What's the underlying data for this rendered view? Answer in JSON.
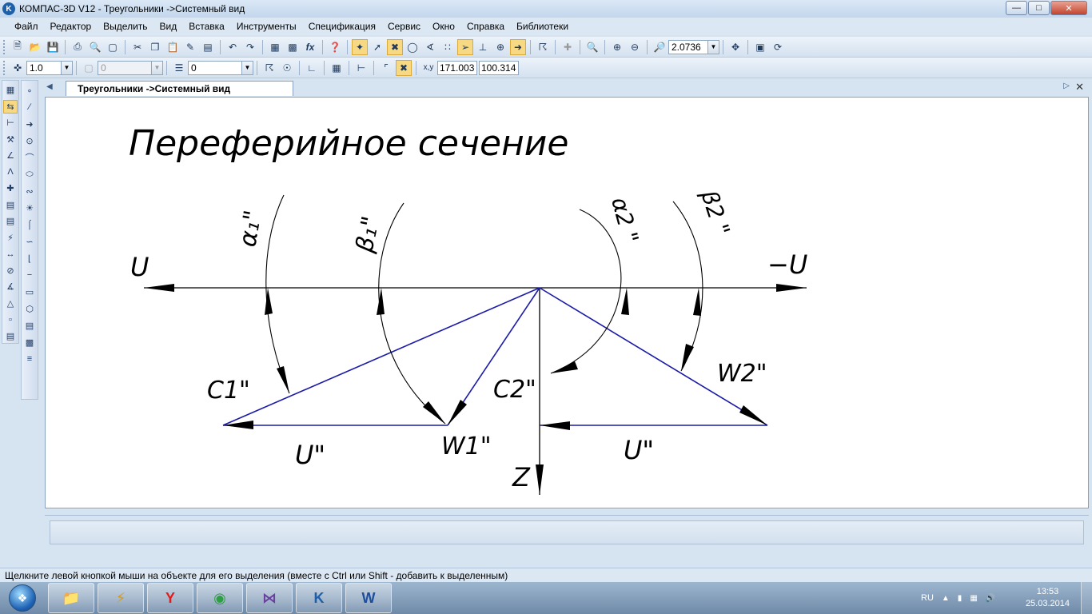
{
  "window": {
    "title": "КОМПАС-3D V12 - Треугольники ->Системный вид",
    "app_icon": "kompas-logo",
    "controls": [
      "minimize",
      "maximize",
      "close"
    ]
  },
  "menu": [
    "Файл",
    "Редактор",
    "Выделить",
    "Вид",
    "Вставка",
    "Инструменты",
    "Спецификация",
    "Сервис",
    "Окно",
    "Справка",
    "Библиотеки"
  ],
  "toolbar1": {
    "zoom_value": "2.0736"
  },
  "toolbar2": {
    "line_scale": "1.0",
    "layer_value": "0",
    "style_value": "0",
    "coord_x": "171.003",
    "coord_y": "100.314"
  },
  "document": {
    "tab_label": "Треугольники ->Системный вид"
  },
  "drawing": {
    "title": "Переферийное сечение",
    "labels": {
      "u_left": "U",
      "u_right": "−U",
      "alpha1": "α₁\"",
      "beta1": "β₁\"",
      "alpha2": "α2 \"",
      "beta2": "β2 \"",
      "c1": "C1\"",
      "c2": "C2\"",
      "w1": "W1\"",
      "w2": "W2\"",
      "u1": "U\"",
      "u2": "U\"",
      "z": "Z"
    },
    "colors": {
      "vector_blue": "#1a1aa8",
      "line_black": "#000000"
    }
  },
  "status": {
    "hint": "Щелкните левой кнопкой мыши на объекте для его выделения (вместе с Ctrl или Shift - добавить к выделенным)"
  },
  "taskbar": {
    "apps": [
      "explorer-icon",
      "winamp-icon",
      "yandex-icon",
      "chrome-icon",
      "visual-studio-icon",
      "kompas-icon",
      "word-icon"
    ],
    "language": "RU",
    "time": "13:53",
    "date": "25.03.2014"
  }
}
